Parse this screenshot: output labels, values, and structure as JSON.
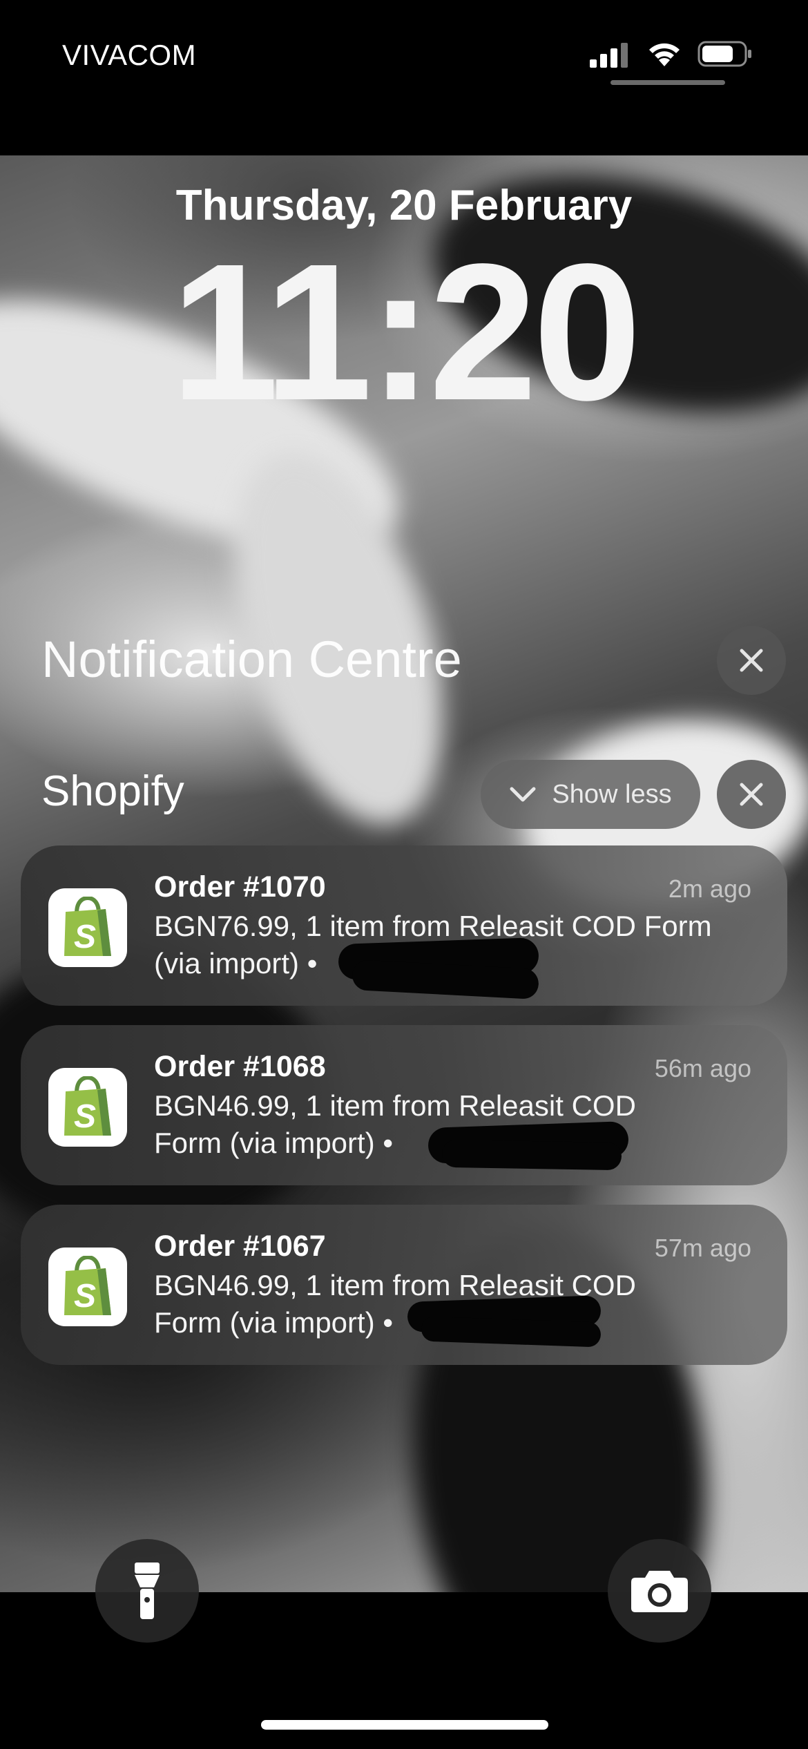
{
  "status_bar": {
    "carrier": "VIVACOM",
    "signal_icon": "cellular-signal-icon",
    "wifi_icon": "wifi-icon",
    "battery_icon": "battery-icon",
    "battery_level": 0.7
  },
  "lock_screen": {
    "date": "Thursday, 20 February",
    "time": "11:20"
  },
  "notification_centre": {
    "title": "Notification Centre",
    "close_icon": "close-icon"
  },
  "group": {
    "app_name": "Shopify",
    "show_less_label": "Show less",
    "show_less_icon": "chevron-down-icon",
    "close_icon": "close-icon"
  },
  "notifications": [
    {
      "title": "Order #1070",
      "time": "2m ago",
      "body_line1": "BGN76.99, 1 item from Releasit COD Form",
      "body_line2": "(via import) •"
    },
    {
      "title": "Order #1068",
      "time": "56m ago",
      "body_line1": "BGN46.99, 1 item from Releasit COD",
      "body_line2": "Form (via import) •"
    },
    {
      "title": "Order #1067",
      "time": "57m ago",
      "body_line1": "BGN46.99, 1 item from Releasit COD",
      "body_line2": "Form (via import) •"
    }
  ],
  "colors": {
    "shopify_green": "#95BF47",
    "card_background": "#3c3c3c"
  },
  "bottom_controls": {
    "flashlight_icon": "flashlight-icon",
    "camera_icon": "camera-icon"
  }
}
